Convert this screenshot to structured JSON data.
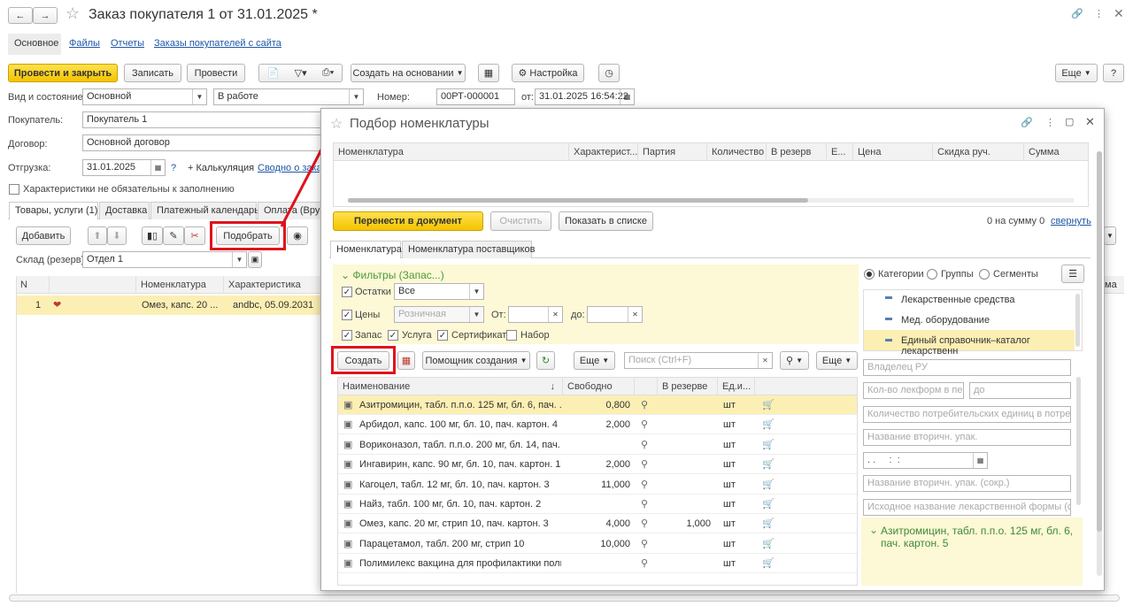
{
  "window": {
    "title": "Заказ покупателя 1 от 31.01.2025 *"
  },
  "nav_tabs": [
    "Основное",
    "Файлы",
    "Отчеты",
    "Заказы покупателей с сайта"
  ],
  "toolbar": {
    "post_close": "Провести и закрыть",
    "save": "Записать",
    "post": "Провести",
    "create_based": "Создать на основании",
    "settings": "Настройка",
    "more": "Еще"
  },
  "form": {
    "kind_label": "Вид и состояние:",
    "kind_value": "Основной",
    "state_value": "В работе",
    "number_label": "Номер:",
    "number_value": "00РТ-000001",
    "date_label": "от:",
    "date_value": "31.01.2025 16:54:22",
    "buyer_label": "Покупатель:",
    "buyer_value": "Покупатель 1",
    "contract_label": "Договор:",
    "contract_value": "Основной договор",
    "shipment_label": "Отгрузка:",
    "shipment_value": "31.01.2025",
    "question": "?",
    "calc_label": "+ Калькуляция",
    "summary_link": "Сводно о заказ",
    "chars_optional": "Характеристики не обязательны к заполнению"
  },
  "doc_tabs": [
    "Товары, услуги (1)",
    "Доставка",
    "Платежный календарь",
    "Оплата (Вруч"
  ],
  "goods": {
    "add": "Добавить",
    "pick": "Подобрать",
    "warehouse_label": "Склад (резерв):",
    "warehouse_value": "Отдел 1",
    "columns": [
      "N",
      "",
      "Номенклатура",
      "Характеристика"
    ],
    "rows": [
      {
        "n": "1",
        "name": "Омез, капс. 20 ...",
        "char": "andbc, 05.09.2031"
      }
    ]
  },
  "right_edge_text": "ма",
  "modal": {
    "title": "Подбор номенклатуры",
    "top_columns": [
      "Номенклатура",
      "Характерист...",
      "Партия",
      "Количество",
      "В резерв",
      "Е...",
      "Цена",
      "Скидка руч.",
      "Сумма"
    ],
    "transfer": "Перенести в документ",
    "clear": "Очистить",
    "show_list": "Показать в списке",
    "sum_text": "0 на сумму 0",
    "collapse": "свернуть",
    "tabs": [
      "Номенклатура",
      "Номенклатура поставщиков"
    ],
    "filters_title": "Фильтры (Запас...)",
    "stock_label": "Остатки",
    "stock_value": "Все",
    "prices_label": "Цены",
    "prices_value": "Розничная",
    "from_label": "От:",
    "to_label": "до:",
    "flag_stock": "Запас",
    "flag_service": "Услуга",
    "flag_cert": "Сертификат",
    "flag_set": "Набор",
    "create": "Создать",
    "wizard": "Помощник создания",
    "more": "Еще",
    "search_placeholder": "Поиск (Ctrl+F)",
    "more2": "Еще",
    "list_columns": [
      "Наименование",
      "Свободно",
      "В резерве",
      "Ед.и..."
    ],
    "sort_arrow": "↓",
    "items": [
      {
        "name": "Азитромицин, табл. п.п.о. 125 мг, бл. 6, пач. ...",
        "free": "0,800",
        "reserve": "",
        "unit": "шт"
      },
      {
        "name": "Арбидол, капс. 100 мг, бл. 10, пач. картон. 4",
        "free": "2,000",
        "reserve": "",
        "unit": "шт"
      },
      {
        "name": "Вориконазол, табл. п.п.о. 200 мг, бл. 14, пач....",
        "free": "",
        "reserve": "",
        "unit": "шт"
      },
      {
        "name": "Ингавирин, капс. 90 мг, бл. 10, пач. картон. 1",
        "free": "2,000",
        "reserve": "",
        "unit": "шт"
      },
      {
        "name": "Кагоцел, табл. 12 мг, бл. 10, пач. картон. 3",
        "free": "11,000",
        "reserve": "",
        "unit": "шт"
      },
      {
        "name": "Найз, табл. 100 мг, бл. 10, пач. картон. 2",
        "free": "",
        "reserve": "",
        "unit": "шт"
      },
      {
        "name": "Омез, капс. 20 мг, стрип 10, пач. картон. 3",
        "free": "4,000",
        "reserve": "1,000",
        "unit": "шт"
      },
      {
        "name": "Парацетамол, табл. 200 мг, стрип 10",
        "free": "10,000",
        "reserve": "",
        "unit": "шт"
      },
      {
        "name": "Полимилекс вакцина для профилактики поли...",
        "free": "",
        "reserve": "",
        "unit": "шт"
      }
    ],
    "view_modes": [
      "Категории",
      "Группы",
      "Сегменты"
    ],
    "categories": [
      "Лекарственные средства",
      "Мед. оборудование",
      "Единый справочник–каталог лекарственн"
    ],
    "attr_placeholders": [
      "Владелец РУ",
      "Кол-во лекформ в пе...",
      "до",
      "Количество потребительских единиц в потреби...",
      "Название вторичн. упак.",
      ". .     :  :",
      "Название вторичн. упак. (сокр.)",
      "Исходное название лекарственной формы (сок..."
    ],
    "selected_info": "Азитромицин, табл. п.п.о. 125 мг, бл. 6, пач. картон. 5"
  },
  "colors": {
    "accent": "#f4c400",
    "highlight": "#e0121b",
    "link": "#1f57a7",
    "selected_row": "#fcefb4",
    "info_panel": "#fdf8d5"
  }
}
